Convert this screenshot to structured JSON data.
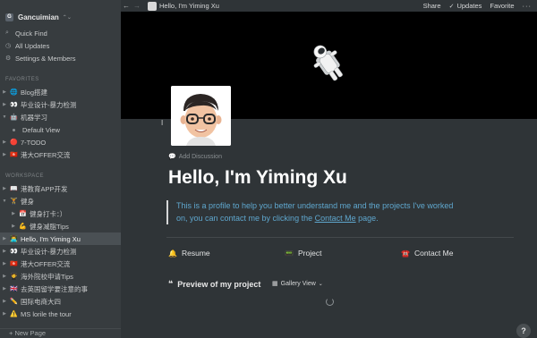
{
  "sidebar": {
    "workspace_name": "Gancuimian",
    "workspace_logo": "G",
    "nav": [
      {
        "icon": "search-icon",
        "glyph": "⌕",
        "label": "Quick Find"
      },
      {
        "icon": "clock-icon",
        "glyph": "◷",
        "label": "All Updates"
      },
      {
        "icon": "gear-icon",
        "glyph": "⚙",
        "label": "Settings & Members"
      }
    ],
    "favorites_header": "FAVORITES",
    "favorites": [
      {
        "toggle": "▶",
        "emoji": "🌐",
        "label": "Blog搭建"
      },
      {
        "toggle": "▶",
        "emoji": "👀",
        "label": "毕业设计-暴力检测"
      },
      {
        "toggle": "▼",
        "emoji": "🤖",
        "label": "机器学习"
      },
      {
        "toggle": "",
        "emoji": "",
        "label": "Default View",
        "child": true
      },
      {
        "toggle": "▶",
        "emoji": "🔴",
        "label": "7-TODO"
      },
      {
        "toggle": "▶",
        "emoji": "🇭🇰",
        "label": "港大OFFER交流"
      }
    ],
    "workspace_header": "WORKSPACE",
    "workspace": [
      {
        "toggle": "▶",
        "emoji": "📖",
        "label": "港教育APP开发"
      },
      {
        "toggle": "▼",
        "emoji": "🏋",
        "label": "健身"
      },
      {
        "toggle": "▶",
        "emoji": "📅",
        "label": "健身打卡：）",
        "indent": true
      },
      {
        "toggle": "▶",
        "emoji": "💪",
        "label": "健身减脂Tips",
        "indent": true
      },
      {
        "toggle": "▶",
        "emoji": "👨‍💻",
        "label": "Hello, I'm Yiming Xu",
        "active": true
      },
      {
        "toggle": "▶",
        "emoji": "👀",
        "label": "毕业设计-暴力检测"
      },
      {
        "toggle": "▶",
        "emoji": "🇭🇰",
        "label": "港大OFFER交流"
      },
      {
        "toggle": "▶",
        "emoji": "🧑‍🎓",
        "label": "海外院校申请Tips"
      },
      {
        "toggle": "▶",
        "emoji": "🇬🇧",
        "label": "去英国留学要注意的事"
      },
      {
        "toggle": "▶",
        "emoji": "✏️",
        "label": "国际电商大四"
      },
      {
        "toggle": "▶",
        "emoji": "⚠️",
        "label": "MS lorile the tour"
      }
    ],
    "new_page": "+ New Page"
  },
  "topbar": {
    "back": "←",
    "forward": "→",
    "breadcrumb": "Hello, I'm Yiming Xu",
    "share": "Share",
    "check": "✓",
    "updates": "Updates",
    "favorite": "Favorite",
    "more": "···"
  },
  "page": {
    "add_discussion": "Add Discussion",
    "discussion_glyph": "💬",
    "title": "Hello, I'm Yiming Xu",
    "quote_part1": "This is a profile to help you better understand me and the projects I've worked on, you can contact me by clicking the ",
    "quote_link": "Contact Me",
    "quote_part2": " page.",
    "links": [
      {
        "emoji": "🔔",
        "label": "Resume"
      },
      {
        "emoji": "📟",
        "label": "Project"
      },
      {
        "emoji": "☎️",
        "label": "Contact Me"
      }
    ],
    "preview_quote": "❝",
    "preview_title": "Preview of my project",
    "gallery_icon": "▦",
    "gallery_view": "Gallery View",
    "gallery_chev": "⌄",
    "help": "?"
  },
  "colors": {
    "background": "#2f3437",
    "sidebar": "#373c3f",
    "cover": "#000000",
    "quote_text": "#5fa7ce",
    "active_item": "#4a5054"
  }
}
